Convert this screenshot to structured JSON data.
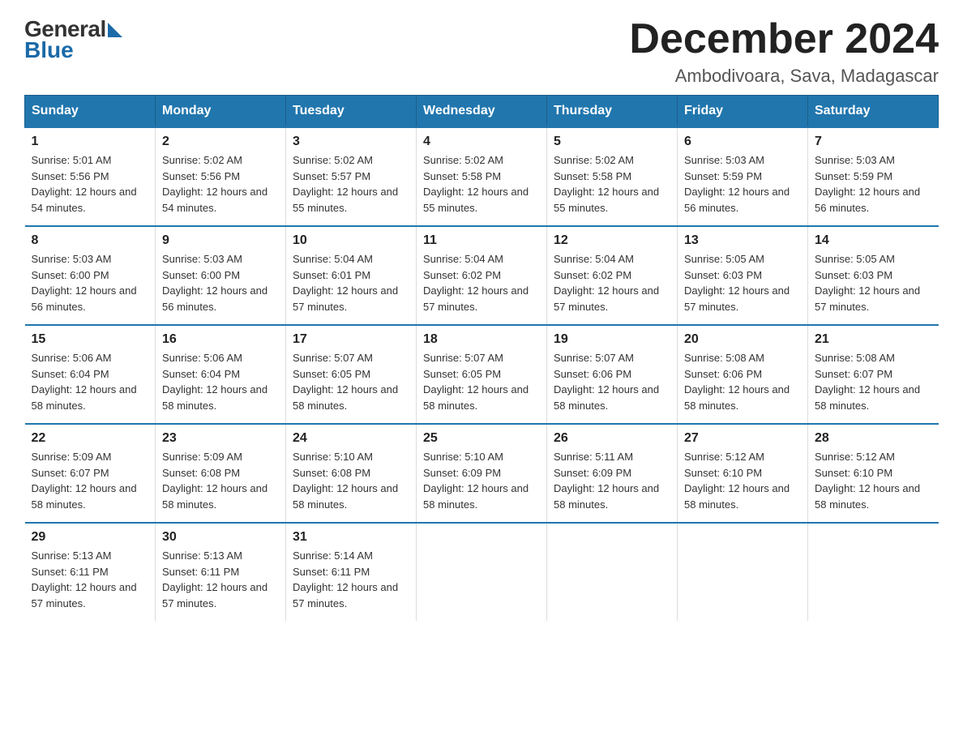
{
  "header": {
    "logo_general": "General",
    "logo_blue": "Blue",
    "title": "December 2024",
    "subtitle": "Ambodivoara, Sava, Madagascar"
  },
  "weekdays": [
    "Sunday",
    "Monday",
    "Tuesday",
    "Wednesday",
    "Thursday",
    "Friday",
    "Saturday"
  ],
  "weeks": [
    [
      {
        "day": "1",
        "sunrise": "5:01 AM",
        "sunset": "5:56 PM",
        "daylight": "12 hours and 54 minutes."
      },
      {
        "day": "2",
        "sunrise": "5:02 AM",
        "sunset": "5:56 PM",
        "daylight": "12 hours and 54 minutes."
      },
      {
        "day": "3",
        "sunrise": "5:02 AM",
        "sunset": "5:57 PM",
        "daylight": "12 hours and 55 minutes."
      },
      {
        "day": "4",
        "sunrise": "5:02 AM",
        "sunset": "5:58 PM",
        "daylight": "12 hours and 55 minutes."
      },
      {
        "day": "5",
        "sunrise": "5:02 AM",
        "sunset": "5:58 PM",
        "daylight": "12 hours and 55 minutes."
      },
      {
        "day": "6",
        "sunrise": "5:03 AM",
        "sunset": "5:59 PM",
        "daylight": "12 hours and 56 minutes."
      },
      {
        "day": "7",
        "sunrise": "5:03 AM",
        "sunset": "5:59 PM",
        "daylight": "12 hours and 56 minutes."
      }
    ],
    [
      {
        "day": "8",
        "sunrise": "5:03 AM",
        "sunset": "6:00 PM",
        "daylight": "12 hours and 56 minutes."
      },
      {
        "day": "9",
        "sunrise": "5:03 AM",
        "sunset": "6:00 PM",
        "daylight": "12 hours and 56 minutes."
      },
      {
        "day": "10",
        "sunrise": "5:04 AM",
        "sunset": "6:01 PM",
        "daylight": "12 hours and 57 minutes."
      },
      {
        "day": "11",
        "sunrise": "5:04 AM",
        "sunset": "6:02 PM",
        "daylight": "12 hours and 57 minutes."
      },
      {
        "day": "12",
        "sunrise": "5:04 AM",
        "sunset": "6:02 PM",
        "daylight": "12 hours and 57 minutes."
      },
      {
        "day": "13",
        "sunrise": "5:05 AM",
        "sunset": "6:03 PM",
        "daylight": "12 hours and 57 minutes."
      },
      {
        "day": "14",
        "sunrise": "5:05 AM",
        "sunset": "6:03 PM",
        "daylight": "12 hours and 57 minutes."
      }
    ],
    [
      {
        "day": "15",
        "sunrise": "5:06 AM",
        "sunset": "6:04 PM",
        "daylight": "12 hours and 58 minutes."
      },
      {
        "day": "16",
        "sunrise": "5:06 AM",
        "sunset": "6:04 PM",
        "daylight": "12 hours and 58 minutes."
      },
      {
        "day": "17",
        "sunrise": "5:07 AM",
        "sunset": "6:05 PM",
        "daylight": "12 hours and 58 minutes."
      },
      {
        "day": "18",
        "sunrise": "5:07 AM",
        "sunset": "6:05 PM",
        "daylight": "12 hours and 58 minutes."
      },
      {
        "day": "19",
        "sunrise": "5:07 AM",
        "sunset": "6:06 PM",
        "daylight": "12 hours and 58 minutes."
      },
      {
        "day": "20",
        "sunrise": "5:08 AM",
        "sunset": "6:06 PM",
        "daylight": "12 hours and 58 minutes."
      },
      {
        "day": "21",
        "sunrise": "5:08 AM",
        "sunset": "6:07 PM",
        "daylight": "12 hours and 58 minutes."
      }
    ],
    [
      {
        "day": "22",
        "sunrise": "5:09 AM",
        "sunset": "6:07 PM",
        "daylight": "12 hours and 58 minutes."
      },
      {
        "day": "23",
        "sunrise": "5:09 AM",
        "sunset": "6:08 PM",
        "daylight": "12 hours and 58 minutes."
      },
      {
        "day": "24",
        "sunrise": "5:10 AM",
        "sunset": "6:08 PM",
        "daylight": "12 hours and 58 minutes."
      },
      {
        "day": "25",
        "sunrise": "5:10 AM",
        "sunset": "6:09 PM",
        "daylight": "12 hours and 58 minutes."
      },
      {
        "day": "26",
        "sunrise": "5:11 AM",
        "sunset": "6:09 PM",
        "daylight": "12 hours and 58 minutes."
      },
      {
        "day": "27",
        "sunrise": "5:12 AM",
        "sunset": "6:10 PM",
        "daylight": "12 hours and 58 minutes."
      },
      {
        "day": "28",
        "sunrise": "5:12 AM",
        "sunset": "6:10 PM",
        "daylight": "12 hours and 58 minutes."
      }
    ],
    [
      {
        "day": "29",
        "sunrise": "5:13 AM",
        "sunset": "6:11 PM",
        "daylight": "12 hours and 57 minutes."
      },
      {
        "day": "30",
        "sunrise": "5:13 AM",
        "sunset": "6:11 PM",
        "daylight": "12 hours and 57 minutes."
      },
      {
        "day": "31",
        "sunrise": "5:14 AM",
        "sunset": "6:11 PM",
        "daylight": "12 hours and 57 minutes."
      },
      null,
      null,
      null,
      null
    ]
  ]
}
